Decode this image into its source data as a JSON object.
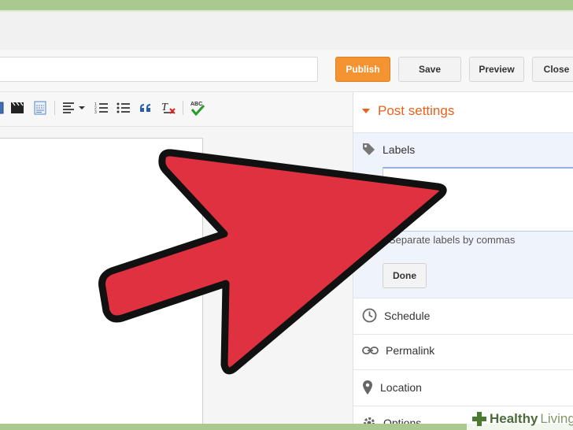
{
  "toolbar": {
    "title_placeholder": "",
    "publish_label": "Publish",
    "save_label": "Save",
    "preview_label": "Preview",
    "close_label": "Close"
  },
  "editor_toolbar": {
    "icons": [
      "image-icon",
      "video-icon",
      "jump-break-icon",
      "align-icon",
      "numbered-list-icon",
      "bullet-list-icon",
      "quote-icon",
      "clear-format-icon",
      "spell-check-icon"
    ],
    "spellcheck_text": "ABC"
  },
  "post_settings": {
    "title": "Post settings",
    "labels": {
      "title": "Labels",
      "value": "",
      "hint": "Separate labels by commas",
      "done_label": "Done"
    },
    "schedule_label": "Schedule",
    "permalink_label": "Permalink",
    "location_label": "Location",
    "options_label": "Options"
  },
  "watermark": {
    "part1": "Healthy",
    "part2": "Living"
  },
  "colors": {
    "accent": "#e8611d",
    "publish": "#f39332",
    "arrow_fill": "#e03140",
    "frame": "#a9c98f"
  }
}
